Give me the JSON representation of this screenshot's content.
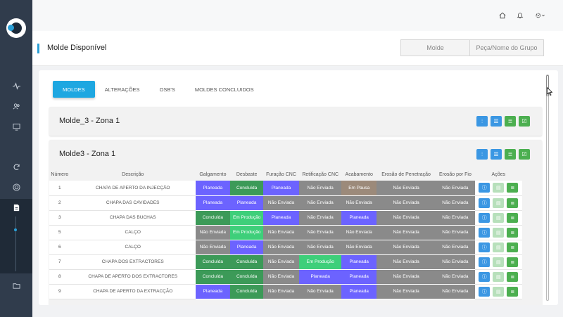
{
  "sidebar": {
    "icons": [
      "activity-icon",
      "users-icon",
      "monitor-icon",
      "refresh-icon",
      "target-icon",
      "document-icon",
      "folder-icon"
    ]
  },
  "topbar": {
    "icons": [
      "home-icon",
      "bell-icon",
      "gear-icon"
    ]
  },
  "header": {
    "title": "Molde Disponível",
    "segments": [
      "Molde",
      "Peça/Nome do Grupo"
    ]
  },
  "tabs": [
    "MOLDES",
    "ALTERAÇÕES",
    "OSB'S",
    "MOLDES CONCLUIDOS"
  ],
  "panels": [
    {
      "title": "Molde_3 - Zona 1"
    },
    {
      "title": "Molde3 - Zona 1"
    }
  ],
  "table": {
    "headers": [
      "Número",
      "Descrição",
      "Galgamento",
      "Desbaste",
      "Furação CNC",
      "Retificação CNC",
      "Acabamento",
      "Erosão de Penetração",
      "Erosão por Fio",
      "Ações"
    ],
    "rows": [
      {
        "num": "1",
        "desc": "CHAPA DE APERTO DA INJECÇÃO",
        "stages": [
          "Planeada",
          "Concluída",
          "Planeada",
          "Não Enviada",
          "Em Pausa",
          "Não Enviada",
          "Não Enviada"
        ]
      },
      {
        "num": "2",
        "desc": "CHAPA DAS CAVIDADES",
        "stages": [
          "Planeada",
          "Planeada",
          "Não Enviada",
          "Não Enviada",
          "Não Enviada",
          "Não Enviada",
          "Não Enviada"
        ]
      },
      {
        "num": "3",
        "desc": "CHAPA DAS BUCHAS",
        "stages": [
          "Concluída",
          "Em Produção",
          "Planeada",
          "Não Enviada",
          "Planeada",
          "Não Enviada",
          "Não Enviada"
        ]
      },
      {
        "num": "5",
        "desc": "CALÇO",
        "stages": [
          "Não Enviada",
          "Em Produção",
          "Não Enviada",
          "Não Enviada",
          "Não Enviada",
          "Não Enviada",
          "Não Enviada"
        ]
      },
      {
        "num": "6",
        "desc": "CALÇO",
        "stages": [
          "Não Enviada",
          "Planeada",
          "Não Enviada",
          "Não Enviada",
          "Não Enviada",
          "Não Enviada",
          "Não Enviada"
        ]
      },
      {
        "num": "7",
        "desc": "CHAPA DOS EXTRACTORES",
        "stages": [
          "Concluída",
          "Concluída",
          "Não Enviada",
          "Em Produção",
          "Planeada",
          "Não Enviada",
          "Não Enviada"
        ]
      },
      {
        "num": "8",
        "desc": "CHAPA DE APERTO DOS EXTRACTORES",
        "stages": [
          "Concluída",
          "Concluída",
          "Não Enviada",
          "Planeada",
          "Planeada",
          "Não Enviada",
          "Não Enviada"
        ]
      },
      {
        "num": "9",
        "desc": "CHAPA DE APERTO DA EXTRACÇÃO",
        "stages": [
          "Planeada",
          "Concluída",
          "Não Enviada",
          "Não Enviada",
          "Planeada",
          "Não Enviada",
          "Não Enviada"
        ]
      }
    ]
  },
  "colors": {
    "accent": "#1ea7e1",
    "Planeada": "#6c63ff",
    "Concluída": "#3c9a58",
    "Não Enviada": "#8a8a8a",
    "Em Produção": "#3ecf7a",
    "Em Pausa": "#9c8a7a"
  }
}
